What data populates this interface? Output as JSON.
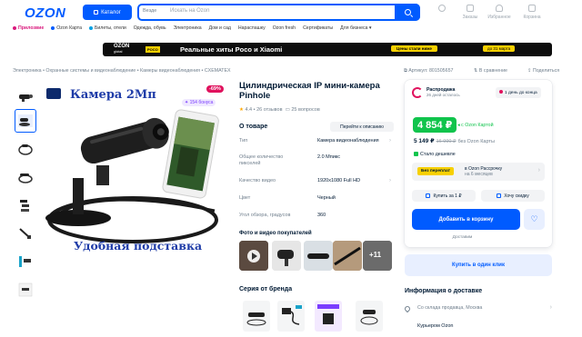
{
  "header": {
    "logo": "OZON",
    "catalog": "Каталог",
    "search_scope": "Везде",
    "search_placeholder": "Искать на Ozon",
    "icons": [
      {
        "name": "profile-icon",
        "label": ""
      },
      {
        "name": "orders-icon",
        "label": "Заказы"
      },
      {
        "name": "favorites-icon",
        "label": "Избранное"
      },
      {
        "name": "cart-icon",
        "label": "Корзина"
      }
    ]
  },
  "subnav": [
    "Прилозвие",
    "Ozon Карта",
    "Билеты, отели",
    "Одежда, обувь",
    "Электроника",
    "Дом и сад",
    "Нараспашку",
    "Ozon fresh",
    "Сертификаты",
    "Для бизнеса"
  ],
  "banner": {
    "logo": "OZON",
    "logo_sub": "global",
    "poco": "POCO",
    "text": "Реальные хиты Poco и Xiaomi",
    "chip": "Цены стали ниже",
    "date": "до 31 марта"
  },
  "breadcrumbs": "Электроника  •  Охранные системы и видеонаблюдение  •  Камеры видеонаблюдения  •  CXEMATEX",
  "meta": {
    "article": "Артикул: 801505657",
    "compare": "В сравнение",
    "share": "Поделиться"
  },
  "gallery": {
    "discount": "-69%",
    "reviews_badge": "154 бонуса",
    "title": "Камера 2Мп",
    "caption": "Удобная подставка"
  },
  "product": {
    "title": "Цилиндрическая IP мини-камера Pinhole",
    "rating": "4.4",
    "reviews": "26 отзывов",
    "questions": "25 вопросов",
    "about": "О товаре",
    "to_specs": "Перейти к описанию",
    "specs": [
      {
        "k": "Тип",
        "v": "Камера видеонаблюдения"
      },
      {
        "k": "Общее количество пикселей",
        "v": "2.0 Мпикс"
      },
      {
        "k": "Качество видео",
        "v": "1920x1080 Full HD"
      },
      {
        "k": "Цвет",
        "v": "Черный"
      },
      {
        "k": "Угол обзора, градусов",
        "v": "360"
      }
    ],
    "photos_title": "Фото и видео покупателей",
    "photos_more": "+11",
    "series_title": "Серия от бренда"
  },
  "card": {
    "sold_title": "Распродажа",
    "sold_sub": "26 дней осталось",
    "delivery_chip": "1 день до конца",
    "price": "4 854 ₽",
    "with_card": "c Ozon Картой",
    "price2": "5 149 ₽",
    "old_price": "16 990 ₽",
    "without_card": "без Ozon Карты",
    "cheaper": "Стало дешевле",
    "no_overpay": "Без переплат",
    "installment": "в Ozon Рассрочку",
    "installment_sub": "на 6 месяцев",
    "buy_for": "Купить за 1 ₽",
    "want_cheaper": "Хочу скидку",
    "add_cart": "Добавить в корзину",
    "delivery": "Доставим"
  },
  "one_click": "Купить в один клик",
  "delivery_info": {
    "title": "Информация о доставке",
    "address": "Со склада продавца, Москва",
    "courier": "Курьером Ozon"
  },
  "colors": {
    "accent": "#005bff",
    "green": "#10c44c",
    "pink": "#e0125d",
    "yellow": "#f7d000"
  }
}
